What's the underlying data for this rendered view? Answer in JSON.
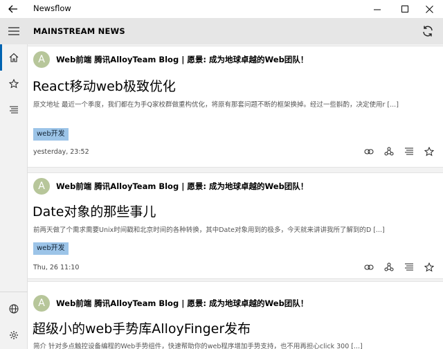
{
  "window": {
    "title": "Newsflow"
  },
  "header": {
    "title": "MAINSTREAM NEWS"
  },
  "sidebar": {
    "items": [
      {
        "icon": "home-icon"
      },
      {
        "icon": "star-icon"
      },
      {
        "icon": "list-icon"
      },
      {
        "icon": "globe-icon"
      },
      {
        "icon": "gear-icon"
      }
    ]
  },
  "articles": [
    {
      "avatar": "A",
      "source": "Web前端 腾讯AlloyTeam  Blog | 愿景: 成为地球卓越的Web团队！",
      "title": "React移动web极致优化",
      "snippet": "原文地址 最近一个季度，我们都在为手Q家校群做重构优化，将原有那套问题不断的框架换掉。经过一些斟酌，决定使用r [...]",
      "tag": "web开发",
      "time": "yesterday, 23:52"
    },
    {
      "avatar": "A",
      "source": "Web前端 腾讯AlloyTeam  Blog | 愿景: 成为地球卓越的Web团队！",
      "title": "Date对象的那些事儿",
      "snippet": "前两天做了个需求需要Unix时间戳和北京时间的各种转换，其中Date对象用到的极多，今天就来讲讲我所了解到的D [...]",
      "tag": "web开发",
      "time": "Thu, 26 11:10"
    },
    {
      "avatar": "A",
      "source": "Web前端 腾讯AlloyTeam  Blog | 愿景: 成为地球卓越的Web团队！",
      "title": "超级小的web手势库AlloyFinger发布",
      "snippet": "简介 针对多点触控设备编程的Web手势组件，快速帮助你的web程序增加手势支持，也不用再担心click 300 [...]"
    }
  ]
}
